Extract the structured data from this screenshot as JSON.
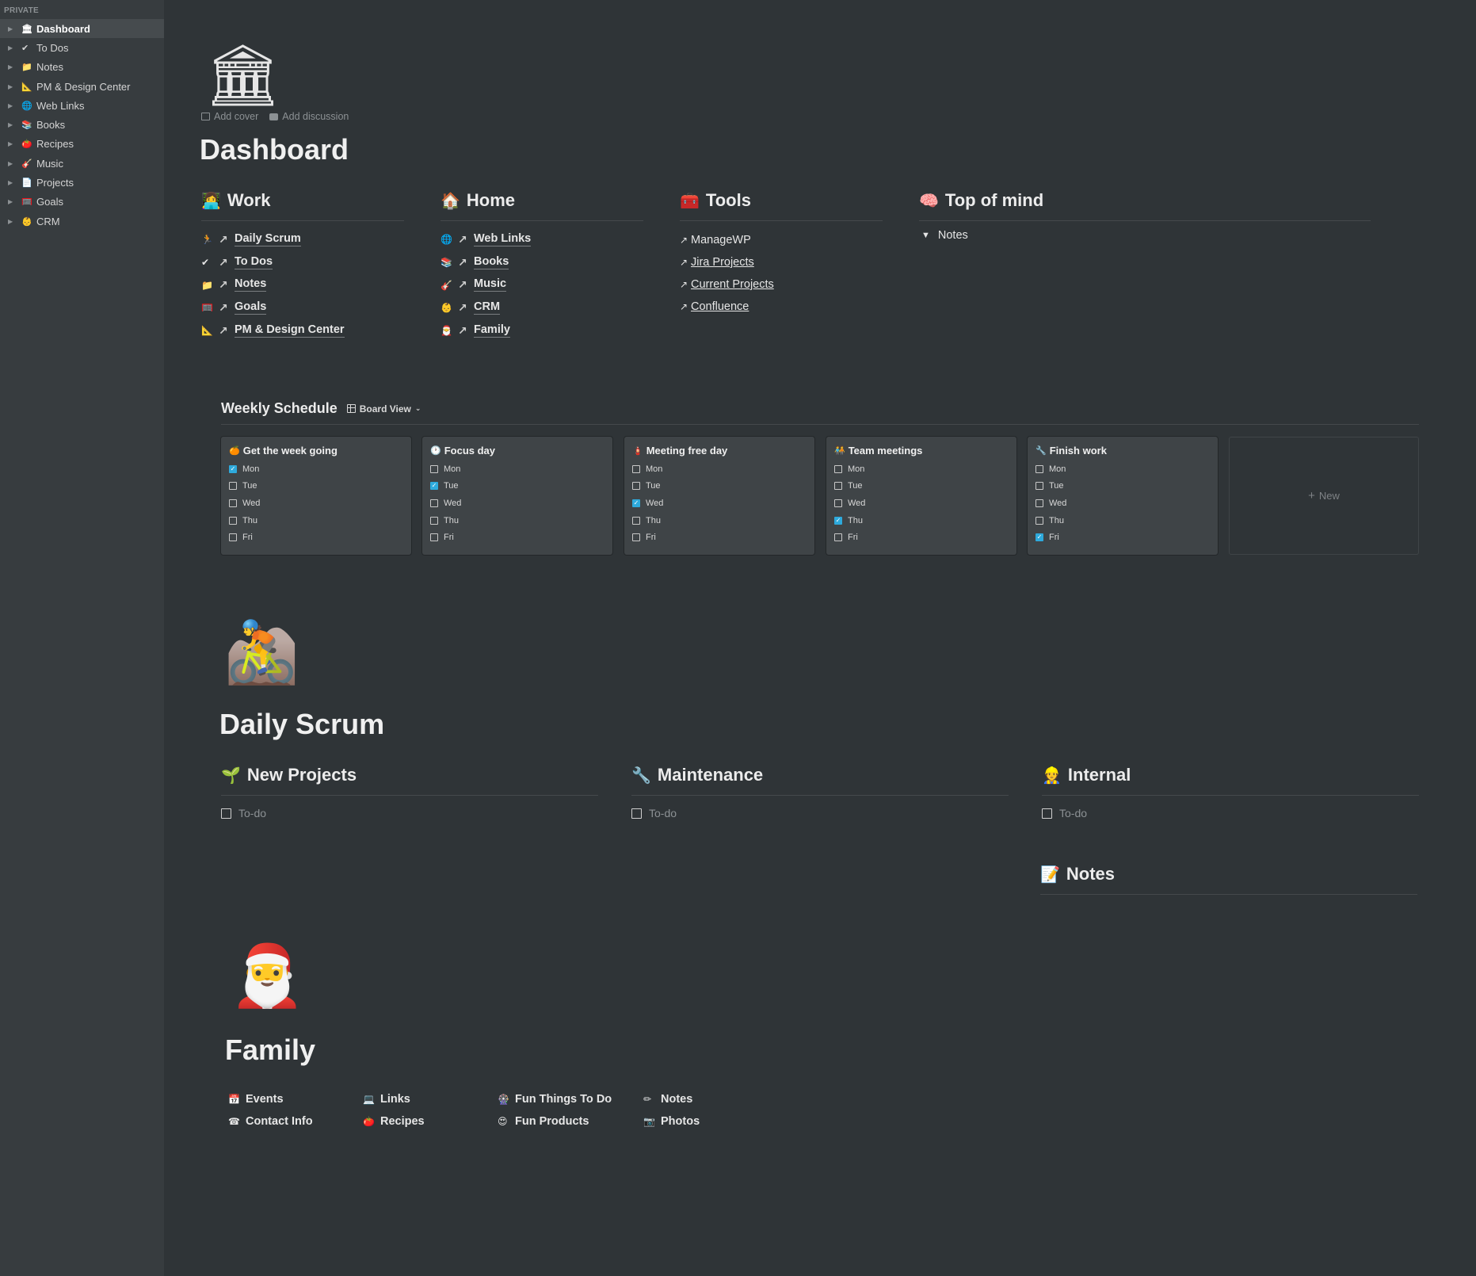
{
  "sidebar": {
    "section": "PRIVATE",
    "items": [
      {
        "icon": "🏛",
        "label": "Dashboard"
      },
      {
        "icon": "✔",
        "label": "To Dos"
      },
      {
        "icon": "📁",
        "label": "Notes"
      },
      {
        "icon": "📐",
        "label": "PM & Design Center"
      },
      {
        "icon": "🌐",
        "label": "Web Links"
      },
      {
        "icon": "📚",
        "label": "Books"
      },
      {
        "icon": "🍅",
        "label": "Recipes"
      },
      {
        "icon": "🎸",
        "label": "Music"
      },
      {
        "icon": "📄",
        "label": "Projects"
      },
      {
        "icon": "🥅",
        "label": "Goals"
      },
      {
        "icon": "👶",
        "label": "CRM"
      }
    ]
  },
  "page": {
    "icon": "🏛",
    "add_cover": "Add cover",
    "add_discussion": "Add discussion",
    "title": "Dashboard"
  },
  "columns": {
    "work": {
      "icon": "👩‍💻",
      "title": "Work",
      "links": [
        {
          "icon": "🏃",
          "label": "Daily Scrum"
        },
        {
          "icon": "✔",
          "label": "To Dos"
        },
        {
          "icon": "📁",
          "label": "Notes"
        },
        {
          "icon": "🥅",
          "label": "Goals"
        },
        {
          "icon": "📐",
          "label": "PM & Design Center"
        }
      ]
    },
    "home": {
      "icon": "🏠",
      "title": "Home",
      "links": [
        {
          "icon": "🌐",
          "label": "Web Links"
        },
        {
          "icon": "📚",
          "label": "Books"
        },
        {
          "icon": "🎸",
          "label": "Music"
        },
        {
          "icon": "👶",
          "label": "CRM"
        },
        {
          "icon": "🎅",
          "label": "Family"
        }
      ]
    },
    "tools": {
      "icon": "🧰",
      "title": "Tools",
      "links": [
        "ManageWP",
        "Jira Projects",
        "Current Projects",
        "Confluence"
      ]
    },
    "top_of_mind": {
      "icon": "🧠",
      "title": "Top of mind",
      "toggle": "Notes"
    }
  },
  "board": {
    "title": "Weekly Schedule",
    "view": "Board View",
    "new_label": "New",
    "cards": [
      {
        "icon": "🍊",
        "title": "Get the week going",
        "days": [
          "Mon",
          "Tue",
          "Wed",
          "Thu",
          "Fri"
        ],
        "checked": [
          true,
          false,
          false,
          false,
          false
        ]
      },
      {
        "icon": "🕐",
        "title": "Focus day",
        "days": [
          "Mon",
          "Tue",
          "Wed",
          "Thu",
          "Fri"
        ],
        "checked": [
          false,
          true,
          false,
          false,
          false
        ]
      },
      {
        "icon": "🧯",
        "title": "Meeting free day",
        "days": [
          "Mon",
          "Tue",
          "Wed",
          "Thu",
          "Fri"
        ],
        "checked": [
          false,
          false,
          true,
          false,
          false
        ]
      },
      {
        "icon": "🧑‍🤝‍🧑",
        "title": "Team meetings",
        "days": [
          "Mon",
          "Tue",
          "Wed",
          "Thu",
          "Fri"
        ],
        "checked": [
          false,
          false,
          false,
          true,
          false
        ]
      },
      {
        "icon": "🔧",
        "title": "Finish work",
        "days": [
          "Mon",
          "Tue",
          "Wed",
          "Thu",
          "Fri"
        ],
        "checked": [
          false,
          false,
          false,
          false,
          true
        ]
      }
    ]
  },
  "scrum": {
    "icon": "🚵",
    "title": "Daily Scrum",
    "sections": [
      {
        "icon": "🌱",
        "title": "New Projects",
        "todo": "To-do"
      },
      {
        "icon": "🔧",
        "title": "Maintenance",
        "todo": "To-do"
      },
      {
        "icon": "👷",
        "title": "Internal",
        "todo": "To-do"
      }
    ],
    "notes": {
      "icon": "📝",
      "title": "Notes"
    }
  },
  "family": {
    "icon": "🎅",
    "title": "Family",
    "links": [
      {
        "icon": "📅",
        "label": "Events"
      },
      {
        "icon": "💻",
        "label": "Links"
      },
      {
        "icon": "🎡",
        "label": "Fun Things To Do"
      },
      {
        "icon": "✏",
        "label": "Notes"
      },
      {
        "icon": "☎",
        "label": "Contact Info"
      },
      {
        "icon": "🍅",
        "label": "Recipes"
      },
      {
        "icon": "😍",
        "label": "Fun Products"
      },
      {
        "icon": "📷",
        "label": "Photos"
      }
    ]
  }
}
